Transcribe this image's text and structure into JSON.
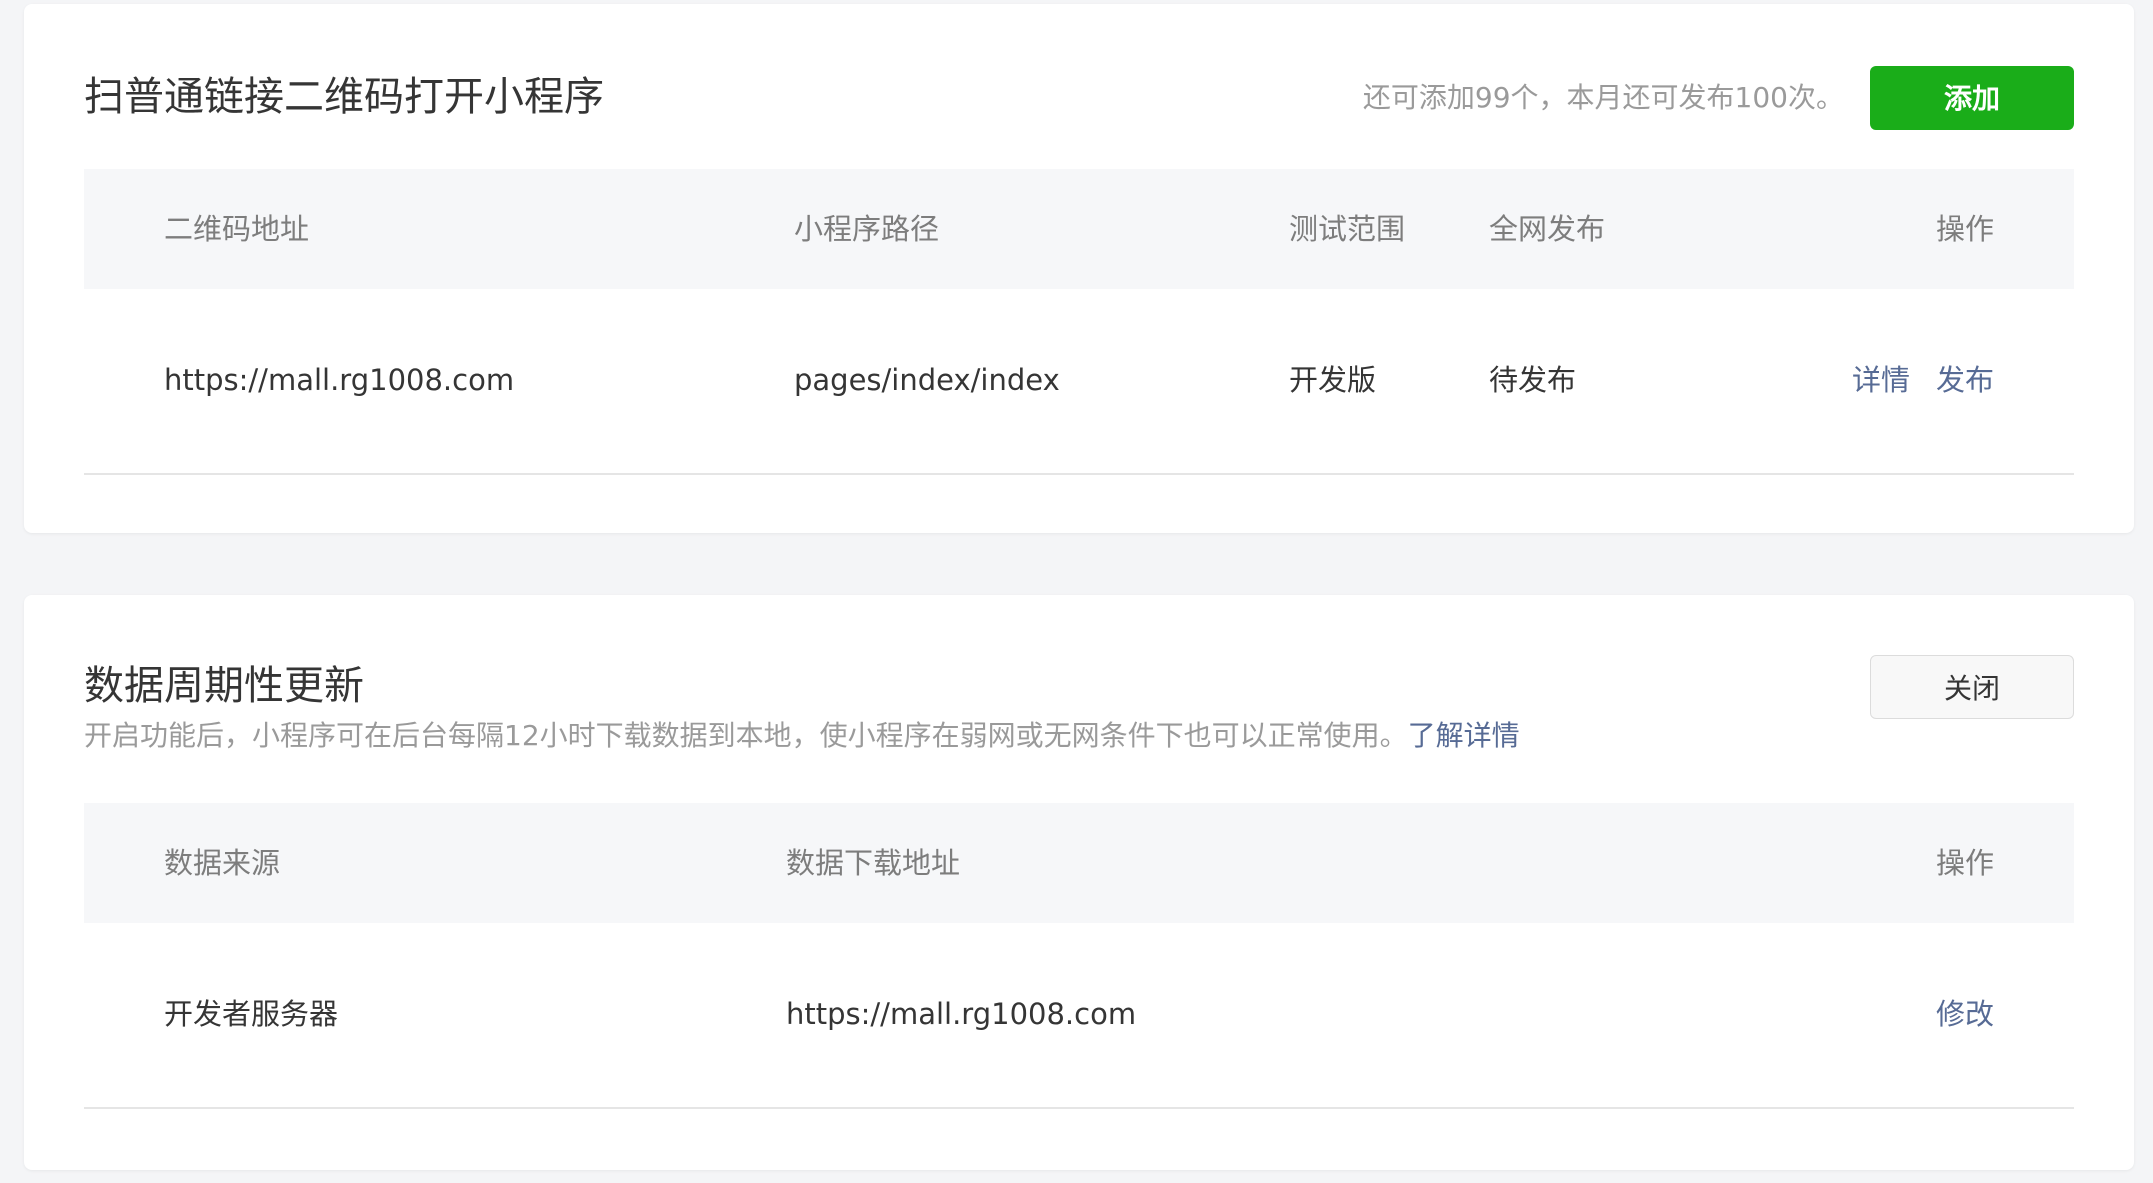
{
  "qr_section": {
    "title": "扫普通链接二维码打开小程序",
    "quota_text": "还可添加99个，本月还可发布100次。",
    "add_button": "添加",
    "columns": {
      "qr_address": "二维码地址",
      "path": "小程序路径",
      "test_scope": "测试范围",
      "publish": "全网发布",
      "operation": "操作"
    },
    "rows": [
      {
        "qr_address": "https://mall.rg1008.com",
        "path": "pages/index/index",
        "test_scope": "开发版",
        "publish": "待发布",
        "detail_link": "详情",
        "publish_link": "发布"
      }
    ]
  },
  "data_section": {
    "title": "数据周期性更新",
    "close_button": "关闭",
    "description": "开启功能后，小程序可在后台每隔12小时下载数据到本地，使小程序在弱网或无网条件下也可以正常使用。",
    "learn_more": "了解详情",
    "columns": {
      "source": "数据来源",
      "download_url": "数据下载地址",
      "operation": "操作"
    },
    "rows": [
      {
        "source": "开发者服务器",
        "download_url": "https://mall.rg1008.com",
        "edit_link": "修改"
      }
    ]
  },
  "colors": {
    "primary_green": "#1aad19",
    "link_blue": "#576b95",
    "page_background": "#f4f5f7",
    "table_header_bg": "#f6f7f9"
  }
}
